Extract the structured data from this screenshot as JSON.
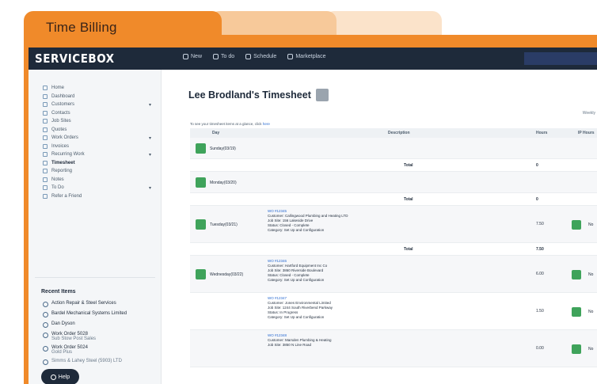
{
  "folder": {
    "title": "Time Billing"
  },
  "app": {
    "logo": "SERVICEBOX",
    "topnav": [
      {
        "label": "New",
        "icon": "plus-icon"
      },
      {
        "label": "To do",
        "icon": "checklist-icon"
      },
      {
        "label": "Schedule",
        "icon": "calendar-icon"
      },
      {
        "label": "Marketplace",
        "icon": "store-icon"
      }
    ]
  },
  "sidebar": {
    "items": [
      {
        "label": "Home",
        "icon": "home-icon"
      },
      {
        "label": "Dashboard",
        "icon": "dashboard-icon"
      },
      {
        "label": "Customers",
        "icon": "users-icon",
        "expand": true
      },
      {
        "label": "Contacts",
        "icon": "contact-icon"
      },
      {
        "label": "Job Sites",
        "icon": "map-pin-icon"
      },
      {
        "label": "Quotes",
        "icon": "quote-icon"
      },
      {
        "label": "Work Orders",
        "icon": "clipboard-icon",
        "expand": true
      },
      {
        "label": "Invoices",
        "icon": "invoice-icon"
      },
      {
        "label": "Recurring Work",
        "icon": "repeat-icon",
        "expand": true
      },
      {
        "label": "Timesheet",
        "icon": "clock-icon",
        "active": true
      },
      {
        "label": "Reporting",
        "icon": "chart-icon"
      },
      {
        "label": "Notes",
        "icon": "note-icon"
      },
      {
        "label": "To Do",
        "icon": "checklist-icon",
        "expand": true
      },
      {
        "label": "Refer a Friend",
        "icon": "gift-icon"
      }
    ],
    "recent_title": "Recent Items",
    "recent": [
      {
        "label": "Action Repair & Steel Services",
        "sub": ""
      },
      {
        "label": "Bardel Mechanical Systems Limited",
        "sub": ""
      },
      {
        "label": "Dan Dyson",
        "sub": ""
      },
      {
        "label": "Work Order 5028",
        "sub": "Sub Stow Post Sales"
      },
      {
        "label": "Work Order 5024",
        "sub": "Gold Plus"
      },
      {
        "label": "",
        "sub": "Simms & Lahey Steel (5903) LTD"
      }
    ],
    "help_label": "Help"
  },
  "main": {
    "title": "Lee Brodland's Timesheet",
    "hint_text": "To see your timesheet items at a glance, click",
    "hint_link": "here",
    "right_note": "Weekly",
    "headers": {
      "day": "Day",
      "description": "Description",
      "hours": "Hours",
      "ip": "IP Hours"
    },
    "total_label": "Total",
    "days": [
      {
        "label": "Sunday(03/19)",
        "entries": [],
        "total": "0"
      },
      {
        "label": "Monday(03/20)",
        "entries": [],
        "total": "0"
      },
      {
        "label": "Tuesday(03/21)",
        "entries": [
          {
            "link": "WO #12345",
            "customer": "Customer: Callingwood Plumbing and Heating LTD",
            "site": "Job Site: 156 Lakeside Drive",
            "status": "Status: Closed - Complete",
            "category": "Category: Set Up and Configuration",
            "hours": "7.50",
            "ip": "No"
          }
        ],
        "total": "7.50"
      },
      {
        "label": "Wednesday(03/22)",
        "entries": [
          {
            "link": "WO #12346",
            "customer": "Customer: Hartford Equipment Inc Co",
            "site": "Job Site: 3860 Riverside Boulevard",
            "status": "Status: Closed - Complete",
            "category": "Category: Set Up and Configuration",
            "hours": "6.00",
            "ip": "No"
          },
          {
            "link": "WO #12347",
            "customer": "Customer: Jones Environmental Limited",
            "site": "Job Site: 1244 South Riverbend Parkway",
            "status": "Status: In Progress",
            "category": "Category: Set Up and Configuration",
            "hours": "1.50",
            "ip": "No"
          },
          {
            "link": "WO #12348",
            "customer": "Customer: Marsden Plumbing & Heating",
            "site": "Job Site: 3850 N Line Road",
            "status": "",
            "category": "",
            "hours": "0.00",
            "ip": "No"
          }
        ],
        "total": ""
      }
    ]
  },
  "colors": {
    "accent": "#f08a2a",
    "nav": "#1e2a3a",
    "green": "#3fa35b",
    "link": "#2a6bd1"
  }
}
